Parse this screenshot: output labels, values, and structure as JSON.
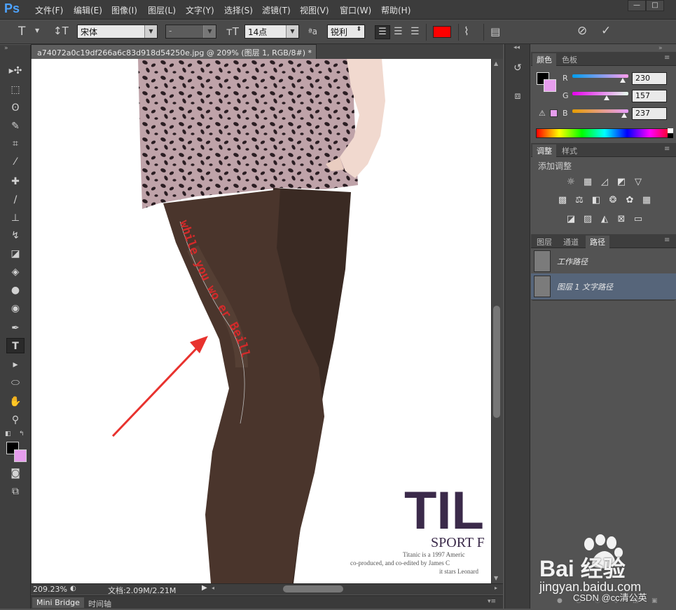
{
  "app": {
    "logo": "Ps"
  },
  "menu": [
    "文件(F)",
    "编辑(E)",
    "图像(I)",
    "图层(L)",
    "文字(Y)",
    "选择(S)",
    "滤镜(T)",
    "视图(V)",
    "窗口(W)",
    "帮助(H)"
  ],
  "window_controls": {
    "minimize": "—",
    "maximize": "□"
  },
  "options": {
    "font_family": "宋体",
    "font_style": "-",
    "font_size": "14点",
    "aa_label": "ªa",
    "antialias": "锐利",
    "text_color": "#ff0000"
  },
  "document": {
    "tab_title": "a74072a0c19df266a6c83d918d54250e.jpg @ 209% (图层 1, RGB/8#) *",
    "close_glyph": "×",
    "path_text": "while you wo er Beill",
    "brand_big": "TIL",
    "brand_sub": "SPORT F",
    "caption_lines": [
      "Titanic is a 1997 Americ",
      "co-produced, and co-edited by James C",
      "it stars Leonard"
    ]
  },
  "status": {
    "zoom": "209.23%",
    "doc_size": "文档:2.09M/2.21M"
  },
  "bottom_tabs": [
    "Mini Bridge",
    "时间轴"
  ],
  "panels": {
    "color": {
      "tabs": [
        "颜色",
        "色板"
      ],
      "channels": [
        {
          "label": "R",
          "value": "230",
          "position": 0.902
        },
        {
          "label": "G",
          "value": "157",
          "position": 0.616
        },
        {
          "label": "B",
          "value": "237",
          "position": 0.929
        }
      ],
      "fg_color": "#000000",
      "bg_color": "#e69ded"
    },
    "adjustments": {
      "tabs": [
        "调整",
        "样式"
      ],
      "title": "添加调整"
    },
    "paths": {
      "tabs": [
        "图层",
        "通道",
        "路径"
      ],
      "items": [
        "工作路径",
        "图层 1 文字路径"
      ]
    }
  },
  "watermark": {
    "logo": "Bai  经验",
    "url": "jingyan.baidu.com",
    "csdn": "CSDN @cc清公英"
  },
  "colors": {
    "accent_blue": "#4da3ff",
    "selected_row": "#56657a",
    "path_text": "#d22a2a",
    "arrow": "#e8322e"
  }
}
